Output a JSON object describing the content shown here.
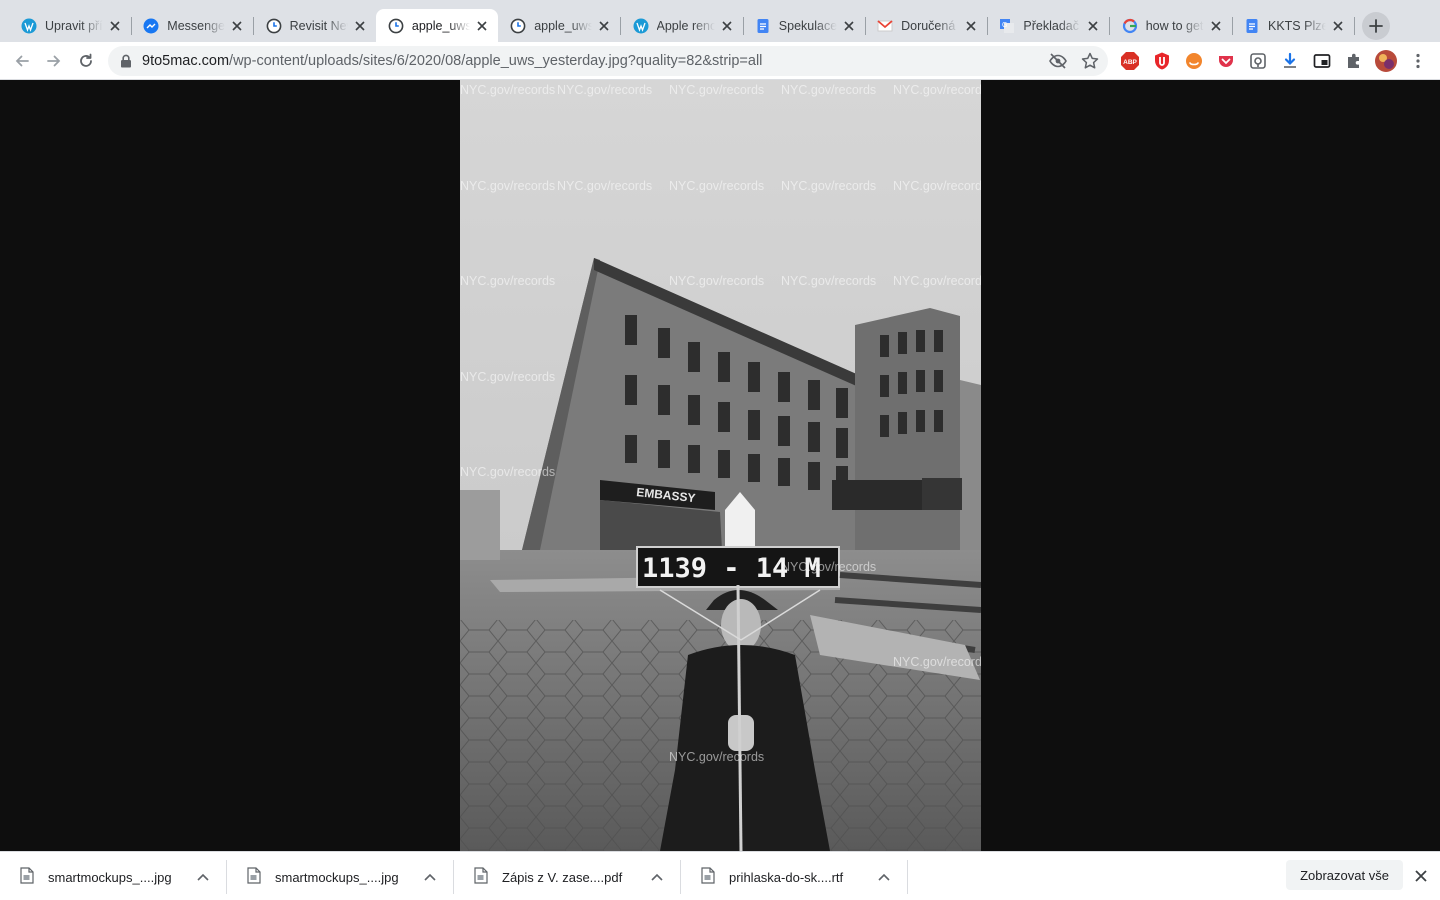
{
  "tabs": [
    {
      "title": "Upravit příspěvek",
      "icon": "wordpress-icon",
      "active": false
    },
    {
      "title": "Messenger",
      "icon": "messenger-icon",
      "active": false
    },
    {
      "title": "Revisit New York",
      "icon": "clock-icon",
      "active": false
    },
    {
      "title": "apple_uws_yesterday.jpg",
      "icon": "clock-icon",
      "active": true
    },
    {
      "title": "apple_uws_today.jpg",
      "icon": "clock-icon",
      "active": false
    },
    {
      "title": "Apple renovates",
      "icon": "wordpress-icon",
      "active": false
    },
    {
      "title": "Spekulace",
      "icon": "docs-icon",
      "active": false
    },
    {
      "title": "Doručená pošta",
      "icon": "gmail-icon",
      "active": false
    },
    {
      "title": "Překladač Google",
      "icon": "translate-icon",
      "active": false
    },
    {
      "title": "how to get",
      "icon": "google-icon",
      "active": false
    },
    {
      "title": "KKTS Plzeň",
      "icon": "docs-icon",
      "active": false
    }
  ],
  "address_bar": {
    "host": "9to5mac.com",
    "path": "/wp-content/uploads/sites/6/2020/08/apple_uws_yesterday.jpg?quality=82&strip=all"
  },
  "photo": {
    "watermark": "NYC.gov/records",
    "sign_text": "1139 - 14  M",
    "marquee_text": "EMBASSY"
  },
  "downloads": [
    {
      "filename": "smartmockups_....jpg",
      "icon": "image-file-icon"
    },
    {
      "filename": "smartmockups_....jpg",
      "icon": "image-file-icon"
    },
    {
      "filename": "Zápis z V. zase....pdf",
      "icon": "pdf-file-icon"
    },
    {
      "filename": "prihlaska-do-sk....rtf",
      "icon": "document-file-icon"
    }
  ],
  "shelf": {
    "show_all_label": "Zobrazovat vše"
  },
  "colors": {
    "tabstrip": "#dee1e6",
    "toolbar": "#ffffff",
    "page_background": "#0e0e0e",
    "adblock_red": "#d93025"
  }
}
